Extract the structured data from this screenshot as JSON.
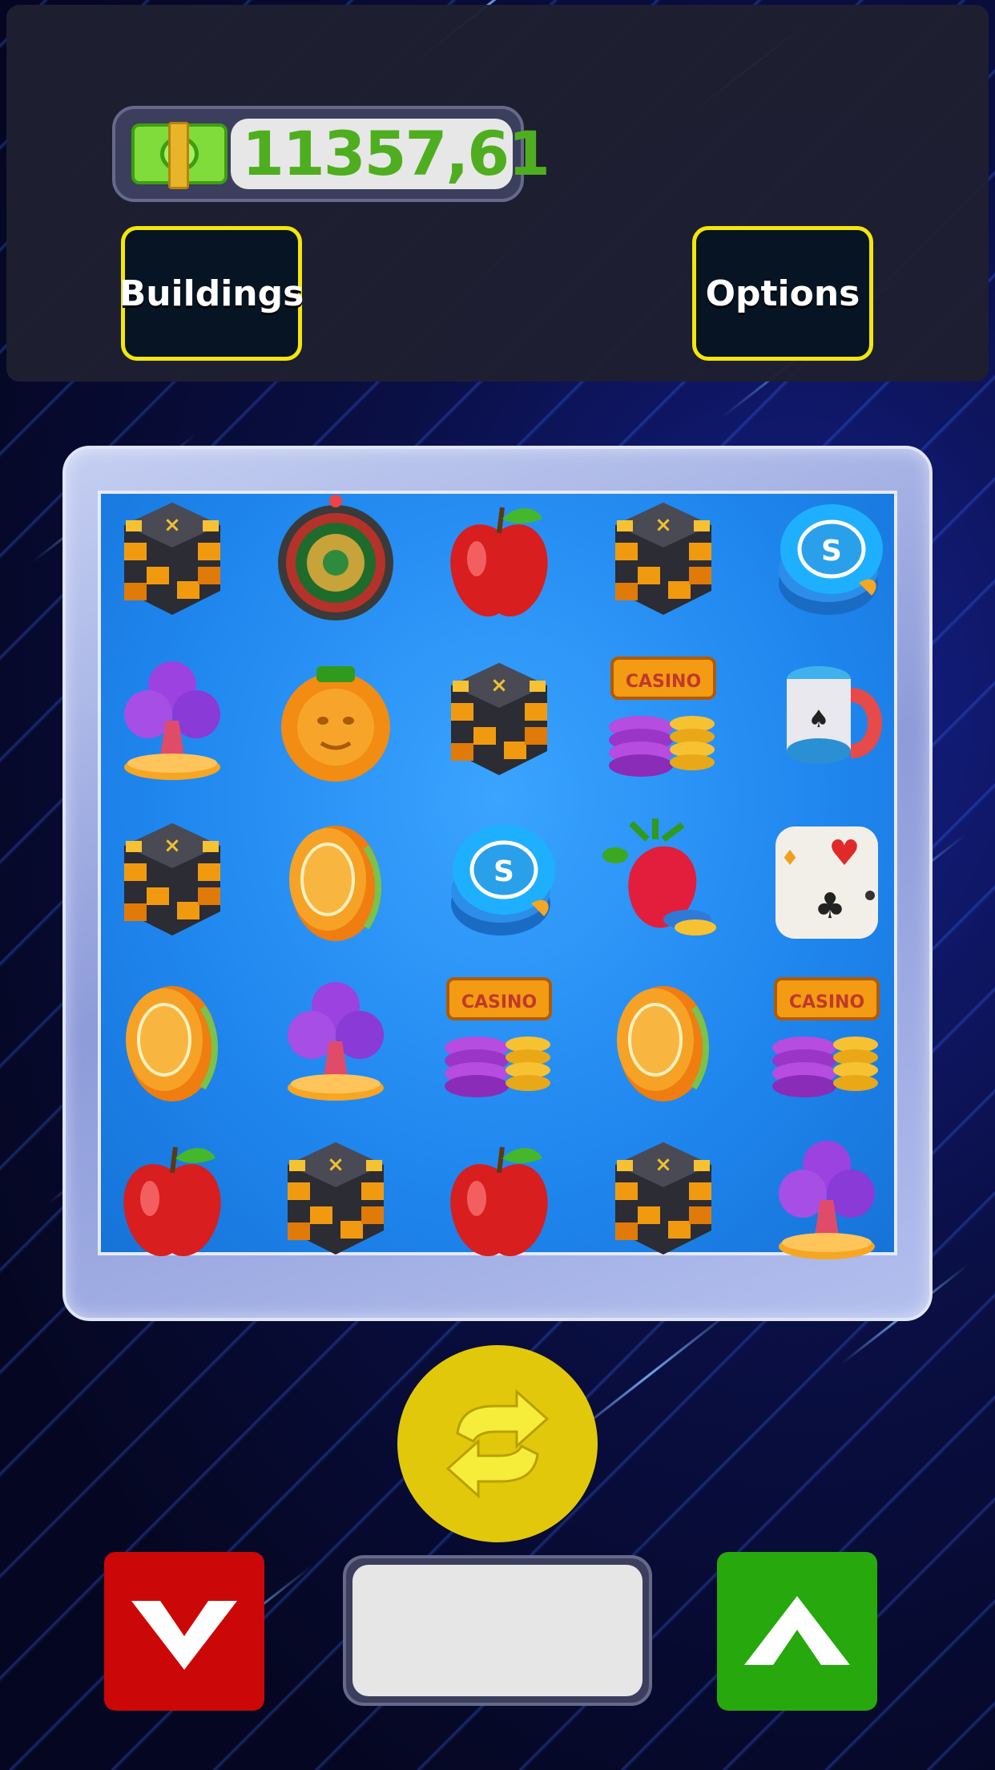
{
  "app": {
    "title": ""
  },
  "colors": {
    "accent_yellow": "#f3e60a",
    "money_green": "#4fae1f",
    "down_red": "#cc0707",
    "up_green": "#27a80d",
    "board_blue": "#1f86ee"
  },
  "header": {
    "balance_icon": "cash-icon",
    "balance": "11357,61",
    "buildings_label": "Buildings",
    "options_label": "Options"
  },
  "board": {
    "rows": [
      [
        "block",
        "roulette",
        "apple",
        "block",
        "chip-blue"
      ],
      [
        "club",
        "orange",
        "block",
        "casino-sign",
        "chip-stack"
      ],
      [
        "block",
        "chip-orange",
        "chip-blue",
        "strawberry",
        "cards-dice"
      ],
      [
        "chip-orange",
        "club",
        "casino-sign",
        "chip-orange",
        "casino-sign"
      ],
      [
        "apple",
        "block",
        "apple",
        "block",
        "club"
      ]
    ],
    "casino_text": "CASINO"
  },
  "controls": {
    "spin_icon": "refresh-icon",
    "down_icon": "chevron-down-icon",
    "up_icon": "chevron-up-icon",
    "bet_value": ""
  }
}
